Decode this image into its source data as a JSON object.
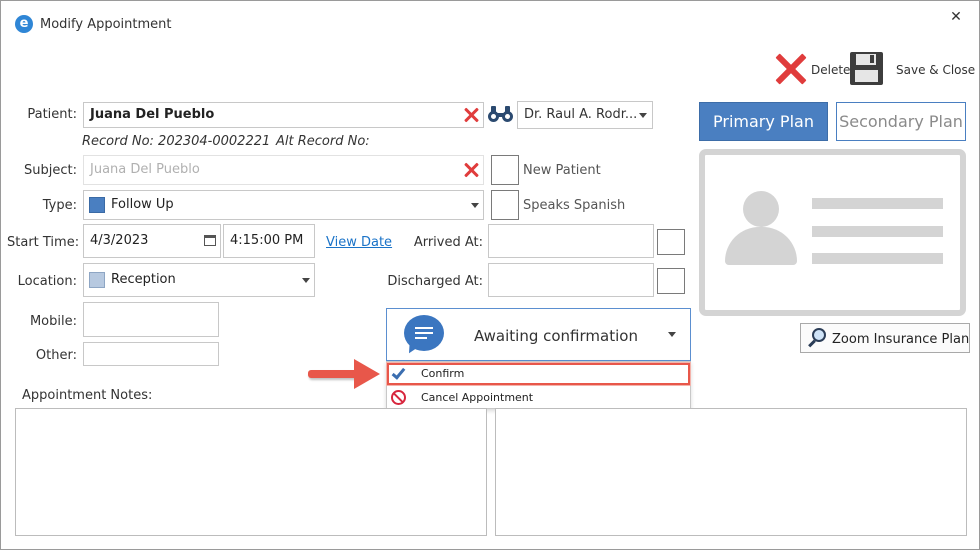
{
  "window": {
    "title": "Modify Appointment",
    "close_glyph": "✕",
    "app_icon": "e"
  },
  "toolbar": {
    "delete_label": "Delete",
    "save_close_label": "Save & Close"
  },
  "form": {
    "patient_label": "Patient:",
    "patient_value": "Juana Del Pueblo",
    "record_no": "Record No: 202304-0002221",
    "alt_record_no": "Alt Record No:",
    "provider_value": "Dr. Raul A. Rodr...",
    "subject_label": "Subject:",
    "subject_value": "Juana Del Pueblo",
    "new_patient_label": "New Patient",
    "type_label": "Type:",
    "type_value": "Follow Up",
    "speaks_spanish_label": "Speaks Spanish",
    "start_time_label": "Start Time:",
    "start_date_value": "4/3/2023",
    "start_time_value": "4:15:00 PM",
    "view_date_link": "View Date",
    "arrived_at_label": "Arrived At:",
    "location_label": "Location:",
    "location_value": "Reception",
    "discharged_at_label": "Discharged At:",
    "mobile_label": "Mobile:",
    "other_label": "Other:",
    "appointment_notes_label": "Appointment Notes:"
  },
  "status_dropdown": {
    "selected": "Awaiting confirmation",
    "options": [
      {
        "label": "Confirm",
        "icon": "checkmark-icon"
      },
      {
        "label": "Cancel Appointment",
        "icon": "prohibited-icon"
      }
    ]
  },
  "insurance": {
    "primary_plan_label": "Primary Plan",
    "secondary_plan_label": "Secondary Plan",
    "zoom_label": "Zoom Insurance Plan"
  },
  "colors": {
    "accent_blue": "#4a7fc1",
    "type_swatch": "#4a7fc1",
    "location_swatch": "#b7c9e0",
    "red_x": "#e03c3c",
    "highlight_red": "#e8574a",
    "link_blue": "#1a73c8",
    "card_gray": "#d4d4d4"
  }
}
